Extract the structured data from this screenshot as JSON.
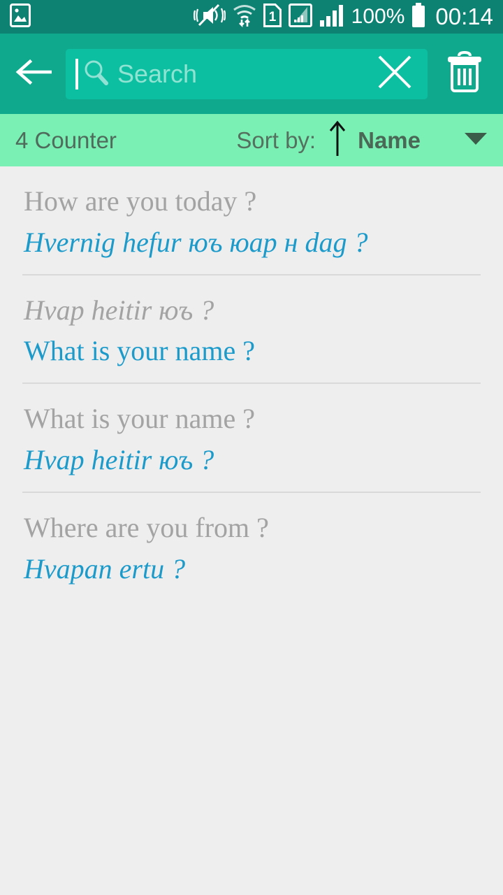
{
  "statusbar": {
    "icons": [
      "gallery-icon",
      "mute-vibrate-icon",
      "wifi-transfer-icon",
      "sim-1-icon",
      "signal-secondary-icon",
      "signal-primary-icon"
    ],
    "sim_label": "1",
    "battery_percent": "100%",
    "clock": "00:14"
  },
  "toolbar": {
    "back_label": "back-arrow",
    "search_placeholder": "Search",
    "search_value": "",
    "clear_label": "clear",
    "delete_label": "delete"
  },
  "sortbar": {
    "counter": "4 Counter",
    "sort_label": "Sort by:",
    "sort_direction": "ascending",
    "sort_value": "Name",
    "dropdown_label": "open-sort-menu"
  },
  "list": {
    "items": [
      {
        "primary": "How are you today ?",
        "secondary": "Hvernig hefur юъ юар н dag ?",
        "primary_italic": false,
        "secondary_italic": true
      },
      {
        "primary": "Hvap heitir юъ ?",
        "secondary": "What is your name ?",
        "primary_italic": true,
        "secondary_italic": false
      },
      {
        "primary": "What is your name ?",
        "secondary": "Hvap heitir юъ ?",
        "primary_italic": false,
        "secondary_italic": true
      },
      {
        "primary": "Where are you from ?",
        "secondary": "Hvapan ertu ?",
        "primary_italic": false,
        "secondary_italic": true
      }
    ]
  },
  "colors": {
    "statusbar_bg": "#0D8272",
    "toolbar_bg": "#0FAA8E",
    "searchfield_bg": "#0CBFA0",
    "sortbar_bg": "#7BF0B4",
    "list_bg": "#EEEEEE",
    "primary_text": "#A3A3A3",
    "secondary_text": "#1C9BCB",
    "divider": "#D9D9D9"
  }
}
